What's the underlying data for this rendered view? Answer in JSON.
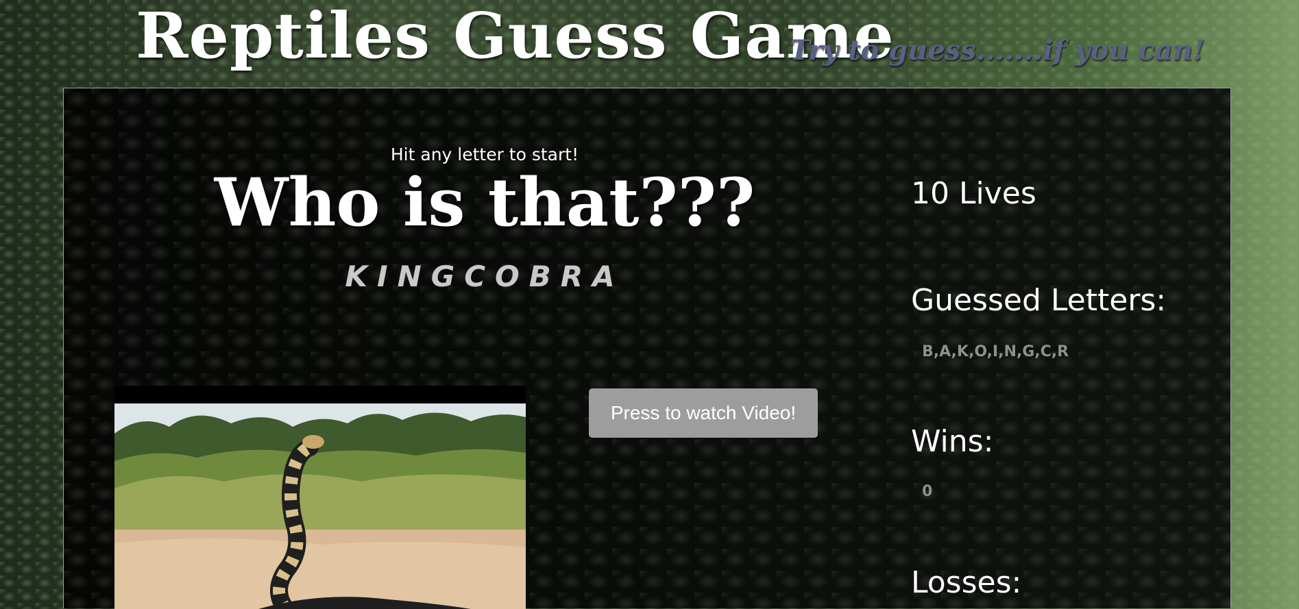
{
  "header": {
    "title": "Reptiles Guess Game",
    "tagline": "Try to guess.......if you can!"
  },
  "game": {
    "start_prompt": "Hit any letter to start!",
    "heading": "Who is that???",
    "current_word": "KINGCOBRA",
    "video_button_label": "Press to watch Video!",
    "image_subject": "king cobra"
  },
  "stats": {
    "lives_text": "10 Lives",
    "guessed_label": "Guessed Letters:",
    "guessed_letters": "B,A,K,O,I,N,G,C,R",
    "wins_label": "Wins:",
    "wins_value": "0",
    "losses_label": "Losses:"
  },
  "colors": {
    "title": "#ffffff",
    "tagline": "#5a5f86",
    "button_bg": "#9d9d9d",
    "word": "#c9c9c9",
    "stat_value": "#8f8f8f"
  }
}
